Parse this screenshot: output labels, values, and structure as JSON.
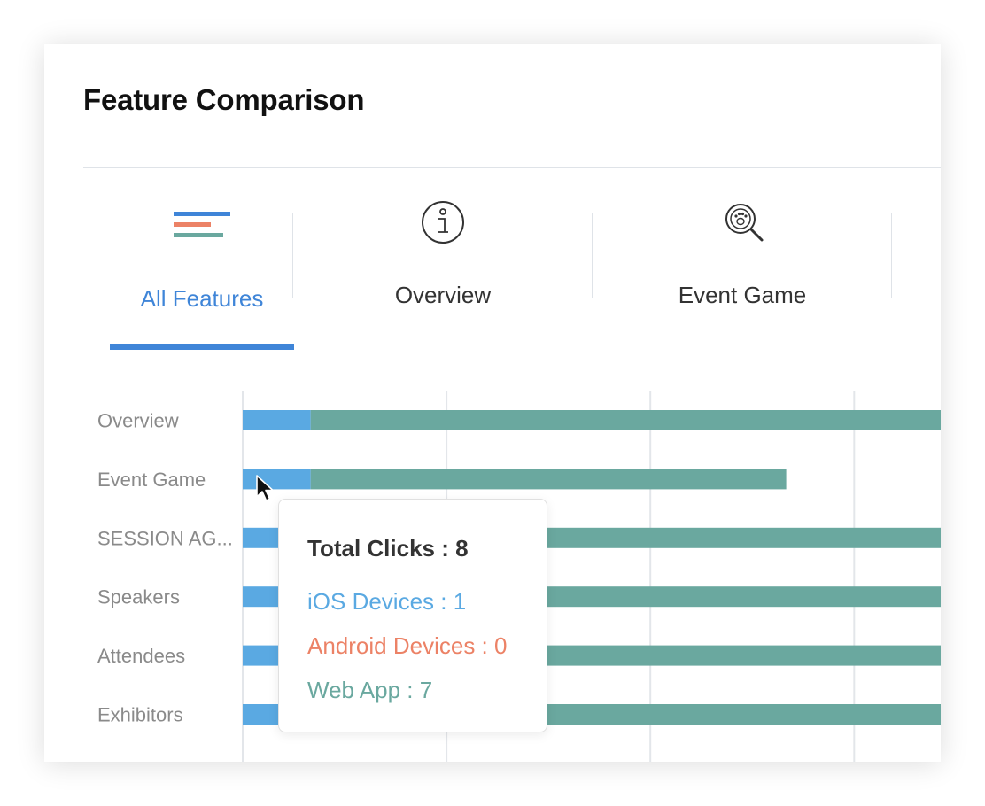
{
  "title": "Feature Comparison",
  "tabs": [
    {
      "label": "All Features",
      "icon": "bars-icon",
      "active": true
    },
    {
      "label": "Overview",
      "icon": "info-icon",
      "active": false
    },
    {
      "label": "Event Game",
      "icon": "paw-magnifier-icon",
      "active": false
    }
  ],
  "colors": {
    "ios": "#5aa9e2",
    "android": "#ec8266",
    "web": "#6aa89f",
    "active_tab": "#3f85d8",
    "grid": "#e3e6ea",
    "category_text": "#8a8a8a"
  },
  "chart_data": {
    "type": "bar",
    "orientation": "horizontal",
    "stacked": true,
    "categories": [
      "Overview",
      "Event Game",
      "SESSION AG...",
      "Speakers",
      "Attendees",
      "Exhibitors"
    ],
    "series": [
      {
        "name": "iOS Devices",
        "values": [
          1,
          1,
          1,
          1,
          1,
          1
        ]
      },
      {
        "name": "Android Devices",
        "values": [
          0,
          0,
          0,
          0,
          0,
          0
        ]
      },
      {
        "name": "Web App",
        "values": [
          12,
          7,
          12,
          12,
          12,
          12
        ]
      }
    ],
    "xlim": [
      0,
      10.5
    ],
    "grid": true
  },
  "tooltip": {
    "title": "Total Clicks : 8",
    "ios": "iOS Devices : 1",
    "android": "Android Devices : 0",
    "web": "Web App : 7"
  }
}
